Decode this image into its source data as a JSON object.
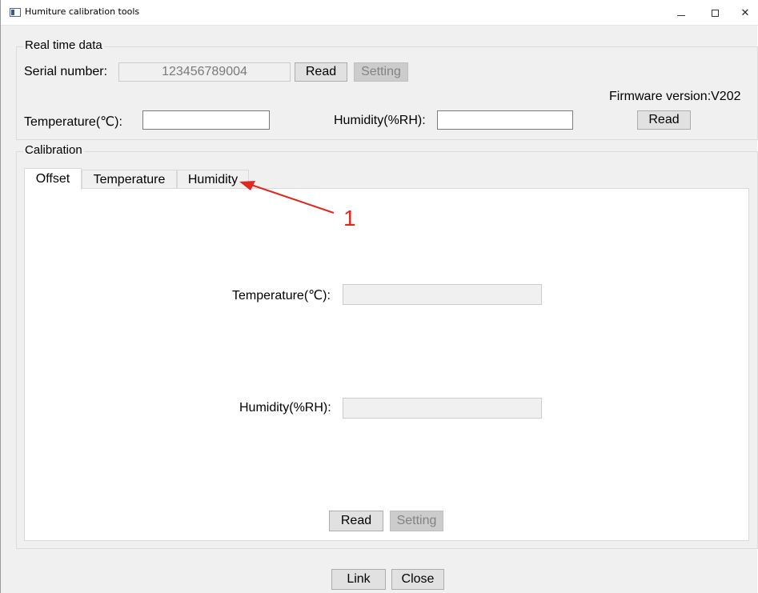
{
  "window": {
    "title": "Humiture calibration tools",
    "minimize_glyph": "–",
    "maximize_glyph": "□",
    "close_glyph": "✕"
  },
  "realtime": {
    "group_title": "Real time data",
    "serial_label": "Serial number:",
    "serial_value": "123456789004",
    "read_button": "Read",
    "setting_button": "Setting",
    "firmware_label": "Firmware version:V202",
    "temperature_label": "Temperature(℃):",
    "temperature_value": "",
    "humidity_label": "Humidity(%RH):",
    "humidity_value": "",
    "read_button_2": "Read"
  },
  "calibration": {
    "group_title": "Calibration",
    "tabs": [
      {
        "label": "Offset",
        "active": true
      },
      {
        "label": "Temperature",
        "active": false
      },
      {
        "label": "Humidity",
        "active": false
      }
    ],
    "offset": {
      "temperature_label": "Temperature(℃):",
      "temperature_value": "",
      "humidity_label": "Humidity(%RH):",
      "humidity_value": "",
      "read_button": "Read",
      "setting_button": "Setting"
    }
  },
  "footer": {
    "link_button": "Link",
    "close_button": "Close"
  },
  "annotation": {
    "number": "1",
    "color": "#e0281f"
  }
}
